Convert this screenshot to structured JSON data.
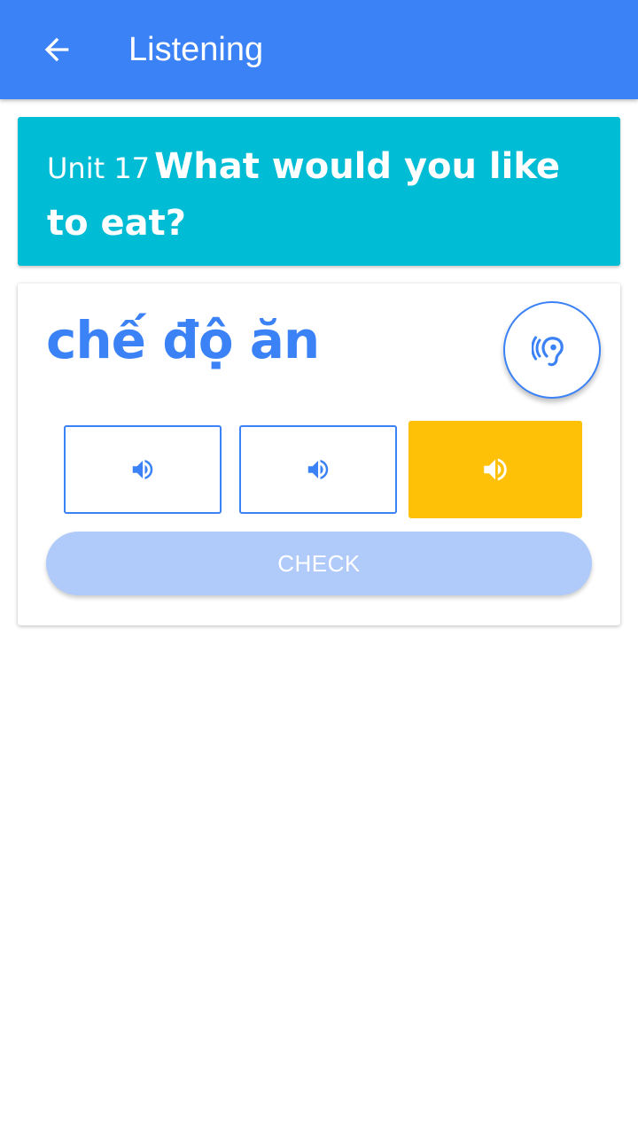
{
  "appbar": {
    "title": "Listening",
    "back_icon": "arrow-back-icon",
    "background_color": "#3B82F6"
  },
  "unit": {
    "label": "Unit 17",
    "title": "What would you like to eat?",
    "background_color": "#00BCD4"
  },
  "quiz": {
    "word": "chế độ ăn",
    "listen_icon": "ear-icon",
    "options": [
      {
        "icon": "speaker-icon",
        "selected": false
      },
      {
        "icon": "speaker-icon",
        "selected": false
      },
      {
        "icon": "speaker-icon",
        "selected": true
      }
    ],
    "check_label": "CHECK"
  },
  "colors": {
    "primary": "#3B82F6",
    "selected": "#FFC107",
    "check_disabled": "#B0CBFA"
  }
}
